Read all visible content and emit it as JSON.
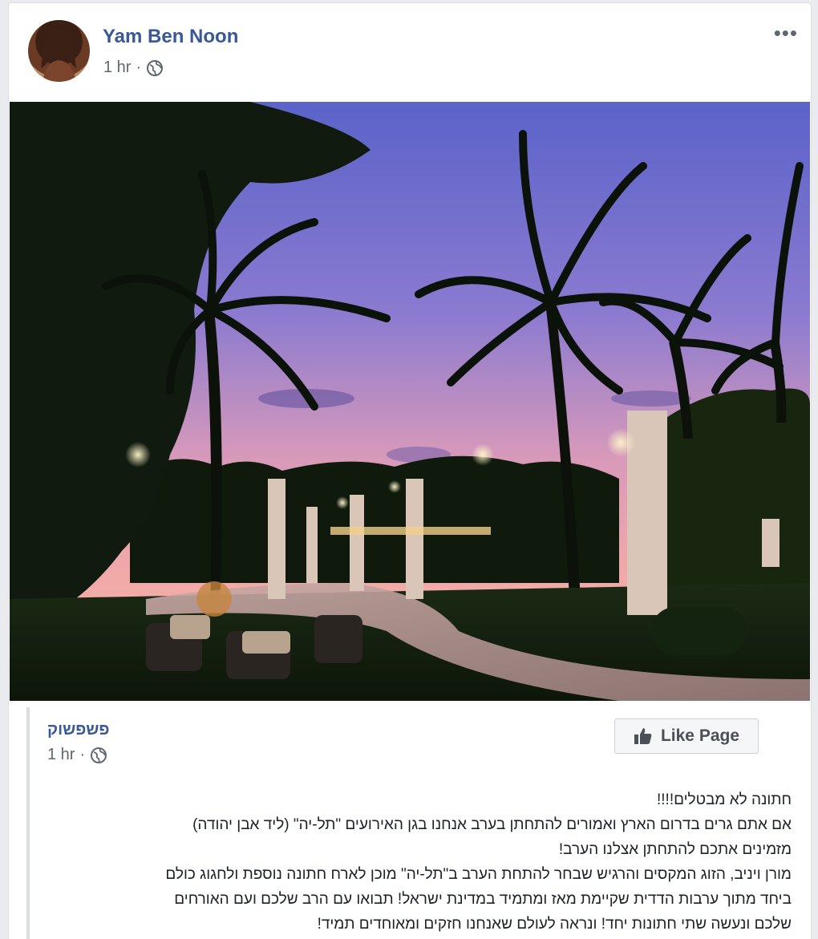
{
  "post": {
    "author": "Yam Ben Noon",
    "time": "1 hr",
    "separator": "·",
    "more_label": "•••",
    "privacy_icon": "globe-icon",
    "photo_description_icon": "photo"
  },
  "shared": {
    "page_name": "פשפשוק",
    "time": "1 hr",
    "separator": "·",
    "privacy_icon": "globe-icon",
    "like_button_label": "Like Page",
    "like_icon": "thumbs-up-icon",
    "lines": [
      "חתונה לא מבטלים!!!!",
      "אם אתם גרים בדרום הארץ ואמורים להתחתן בערב אנחנו בגן האירועים \"תל-יה\" (ליד אבן יהודה)",
      "מזמינים אתכם להתחתן אצלנו הערב!",
      "מורן ויניב, הזוג המקסים והרגיש שבחר להתחת הערב ב\"תל-יה\" מוכן לארח חתונה נוספת ולחגוג כולם",
      "ביחד מתוך ערבות הדדית שקיימת מאז ומתמיד במדינת ישראל! תבואו עם הרב שלכם ועם האורחים",
      "שלכם ונעשה שתי חתונות יחד! ונראה לעולם שאנחנו חזקים ומאוחדים תמיד!"
    ]
  },
  "colors": {
    "link": "#385898",
    "meta": "#616770",
    "text": "#1d2129",
    "sky_top": "#5a64c8",
    "sky_bottom": "#f2a3b0"
  }
}
